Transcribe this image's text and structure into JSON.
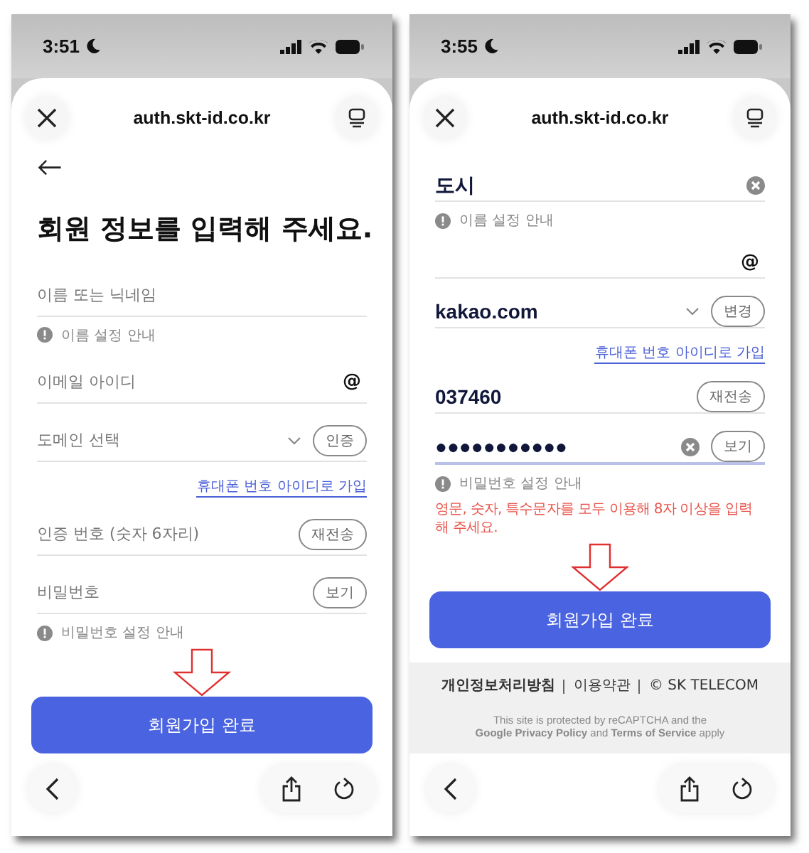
{
  "screens": [
    {
      "status": {
        "time": "3:51"
      },
      "url": "auth.skt-id.co.kr",
      "items": [
        {
          "kind": "back"
        },
        {
          "kind": "heading",
          "text": "회원 정보를 입력해 주세요."
        },
        {
          "kind": "field",
          "placeholder": "이름 또는 닉네임"
        },
        {
          "kind": "hint",
          "text": "이름 설정 안내"
        },
        {
          "kind": "field",
          "placeholder": "이메일 아이디",
          "suffix": "@"
        },
        {
          "kind": "field",
          "placeholder": "도메인 선택",
          "dropdown": true,
          "button": "인증"
        },
        {
          "kind": "link",
          "text": "휴대폰 번호 아이디로 가입"
        },
        {
          "kind": "field",
          "placeholder": "인증 번호 (숫자 6자리)",
          "button": "재전송"
        },
        {
          "kind": "field",
          "placeholder": "비밀번호",
          "button": "보기"
        },
        {
          "kind": "hint",
          "text": "비밀번호 설정 안내"
        },
        {
          "kind": "arrow"
        },
        {
          "kind": "submit",
          "text": "회원가입 완료"
        }
      ]
    },
    {
      "status": {
        "time": "3:55"
      },
      "url": "auth.skt-id.co.kr",
      "items": [
        {
          "kind": "field",
          "value": "도시",
          "clear": true
        },
        {
          "kind": "hint",
          "text": "이름 설정 안내"
        },
        {
          "kind": "field",
          "suffix": "@"
        },
        {
          "kind": "field",
          "value": "kakao.com",
          "dropdown": true,
          "button": "변경"
        },
        {
          "kind": "link",
          "text": "휴대폰 번호 아이디로 가입"
        },
        {
          "kind": "field",
          "value": "037460",
          "button": "재전송"
        },
        {
          "kind": "field",
          "value": "●●●●●●●●●●●",
          "clear": true,
          "button": "보기",
          "focused": true
        },
        {
          "kind": "hint",
          "text": "비밀번호 설정 안내"
        },
        {
          "kind": "error",
          "text": "영문, 숫자, 특수문자를 모두 이용해 8자 이상을 입력해 주세요."
        },
        {
          "kind": "arrow"
        },
        {
          "kind": "submit",
          "text": "회원가입 완료"
        },
        {
          "kind": "footer",
          "links": [
            "개인정보처리방침",
            "이용약관",
            "© SK TELECOM"
          ],
          "notice": [
            "This site is protected by reCAPTCHA and the",
            "**Google Privacy Policy** and **Terms of Service** apply"
          ]
        }
      ]
    }
  ]
}
